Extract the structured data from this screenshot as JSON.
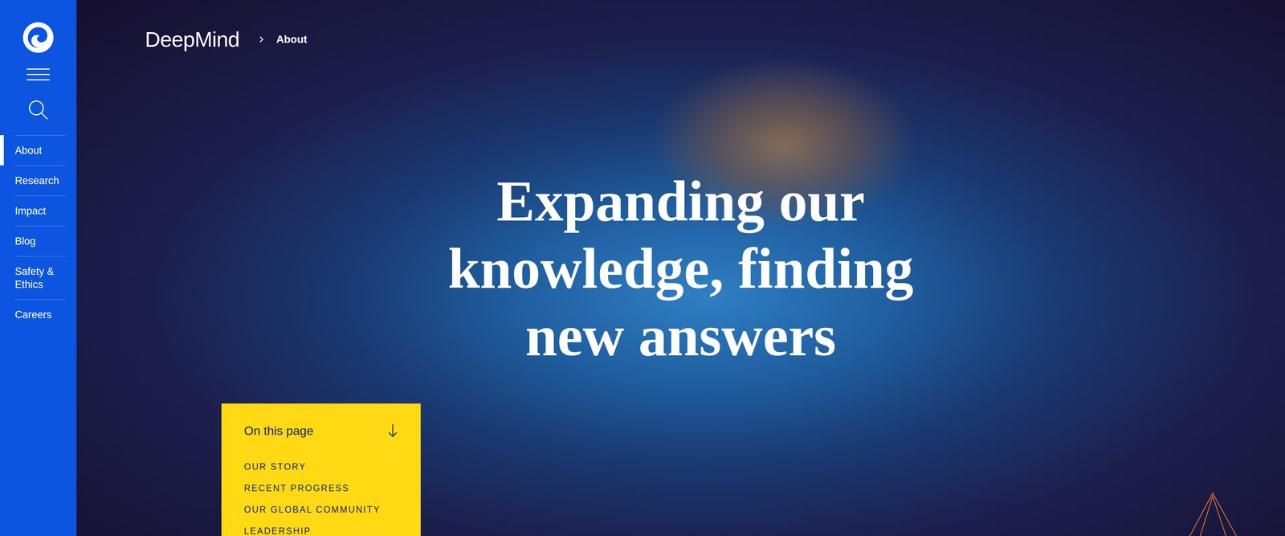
{
  "sidebar": {
    "items": [
      {
        "label": "About",
        "selected": true
      },
      {
        "label": "Research",
        "selected": false
      },
      {
        "label": "Impact",
        "selected": false
      },
      {
        "label": "Blog",
        "selected": false
      },
      {
        "label": "Safety & Ethics",
        "selected": false
      },
      {
        "label": "Careers",
        "selected": false
      }
    ]
  },
  "breadcrumb": {
    "brand": "DeepMind",
    "current": "About"
  },
  "headline": {
    "lines": [
      "Expanding our",
      "knowledge, finding",
      "new answers"
    ]
  },
  "on_this_page": {
    "title": "On this page",
    "items": [
      "OUR STORY",
      "RECENT PROGRESS",
      "OUR GLOBAL COMMUNITY",
      "LEADERSHIP"
    ]
  }
}
